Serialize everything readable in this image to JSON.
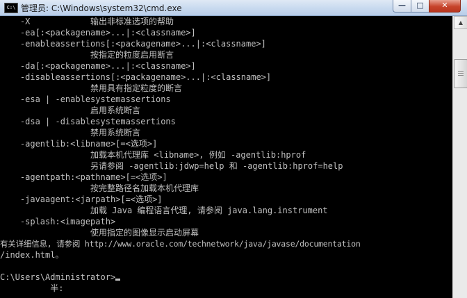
{
  "window": {
    "title": "管理员: C:\\Windows\\system32\\cmd.exe",
    "icon": "C:\\",
    "buttons": {
      "minimize": "—",
      "maximize": "□",
      "close": "✕"
    }
  },
  "console": {
    "lines": [
      "    -X            输出非标准选项的帮助",
      "    -ea[:<packagename>...|:<classname>]",
      "    -enableassertions[:<packagename>...|:<classname>]",
      "                  按指定的粒度启用断言",
      "    -da[:<packagename>...|:<classname>]",
      "    -disableassertions[:<packagename>...|:<classname>]",
      "                  禁用具有指定粒度的断言",
      "    -esa | -enablesystemassertions",
      "                  启用系统断言",
      "    -dsa | -disablesystemassertions",
      "                  禁用系统断言",
      "    -agentlib:<libname>[=<选项>]",
      "                  加载本机代理库 <libname>, 例如 -agentlib:hprof",
      "                  另请参阅 -agentlib:jdwp=help 和 -agentlib:hprof=help",
      "    -agentpath:<pathname>[=<选项>]",
      "                  按完整路径名加载本机代理库",
      "    -javaagent:<jarpath>[=<选项>]",
      "                  加载 Java 编程语言代理, 请参阅 java.lang.instrument",
      "    -splash:<imagepath>",
      "                  使用指定的图像显示启动屏幕",
      "有关详细信息, 请参阅 http://www.oracle.com/technetwork/java/javase/documentation",
      "/index.html。",
      "",
      "C:\\Users\\Administrator>",
      "          半:"
    ]
  },
  "scrollbar": {
    "up_arrow": "▲"
  }
}
